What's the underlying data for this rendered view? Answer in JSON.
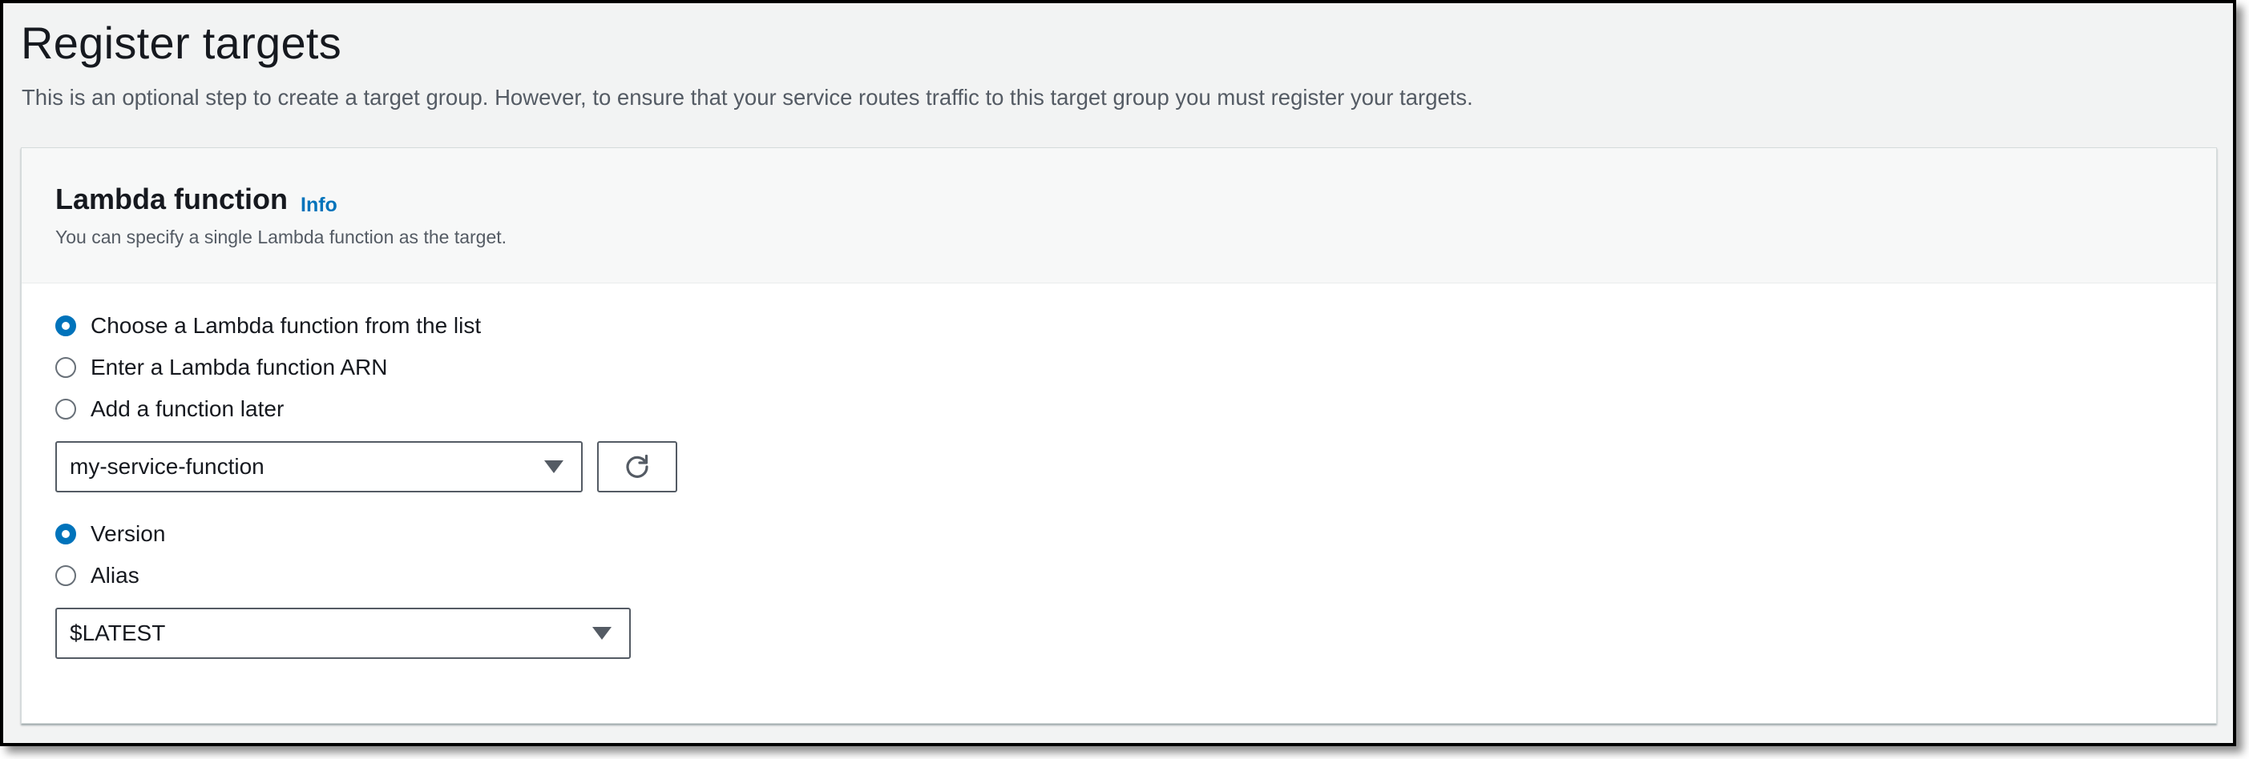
{
  "page": {
    "title": "Register targets",
    "description": "This is an optional step to create a target group. However, to ensure that your service routes traffic to this target group you must register your targets."
  },
  "panel": {
    "title": "Lambda function",
    "info_label": "Info",
    "description": "You can specify a single Lambda function as the target."
  },
  "function_source": {
    "options": [
      {
        "label": "Choose a Lambda function from the list",
        "selected": true
      },
      {
        "label": "Enter a Lambda function ARN",
        "selected": false
      },
      {
        "label": "Add a function later",
        "selected": false
      }
    ]
  },
  "function_select": {
    "value": "my-service-function",
    "icon": "caret-down-icon"
  },
  "refresh_button": {
    "icon": "refresh-icon"
  },
  "version_type": {
    "options": [
      {
        "label": "Version",
        "selected": true
      },
      {
        "label": "Alias",
        "selected": false
      }
    ]
  },
  "version_select": {
    "value": "$LATEST",
    "icon": "caret-down-icon"
  },
  "colors": {
    "accent": "#0073bb",
    "page_background": "#f2f3f3",
    "panel_header_background": "#f7f8f8",
    "text_primary": "#16191f",
    "text_secondary": "#545b64"
  }
}
